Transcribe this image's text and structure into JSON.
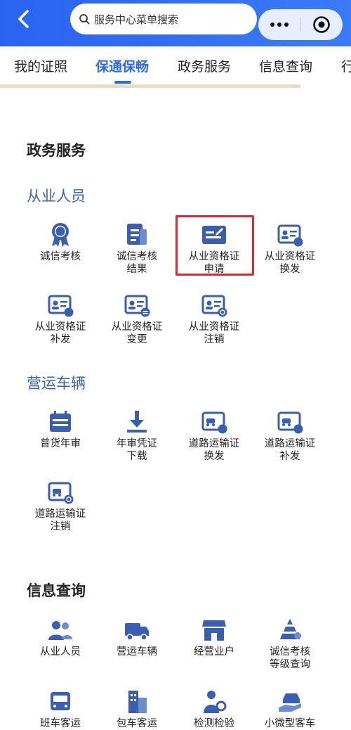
{
  "header": {
    "search_placeholder": "服务中心菜单搜索"
  },
  "tabs": [
    "我的证照",
    "保通保畅",
    "政务服务",
    "信息查询",
    "行"
  ],
  "sections": {
    "gov": {
      "title": "政务服务",
      "practitioners": {
        "title": "从业人员",
        "items": [
          "诚信考核",
          "诚信考核\n结果",
          "从业资格证\n申请",
          "从业资格证\n换发",
          "从业资格证\n补发",
          "从业资格证\n变更",
          "从业资格证\n注销"
        ]
      },
      "vehicles": {
        "title": "营运车辆",
        "items": [
          "普货年审",
          "年审凭证\n下载",
          "道路运输证\n换发",
          "道路运输证\n补发",
          "道路运输证\n注销"
        ]
      }
    },
    "info": {
      "title": "信息查询",
      "items": [
        "从业人员",
        "营运车辆",
        "经营业户",
        "诚信考核\n等级查询",
        "班车客运",
        "包车客运",
        "检测检验",
        "小微型客车"
      ]
    }
  },
  "colors": {
    "accent": "#2f6af0",
    "icon": "#3a5fb0",
    "group_title": "#3a63b5",
    "highlight": "#e0282e"
  }
}
